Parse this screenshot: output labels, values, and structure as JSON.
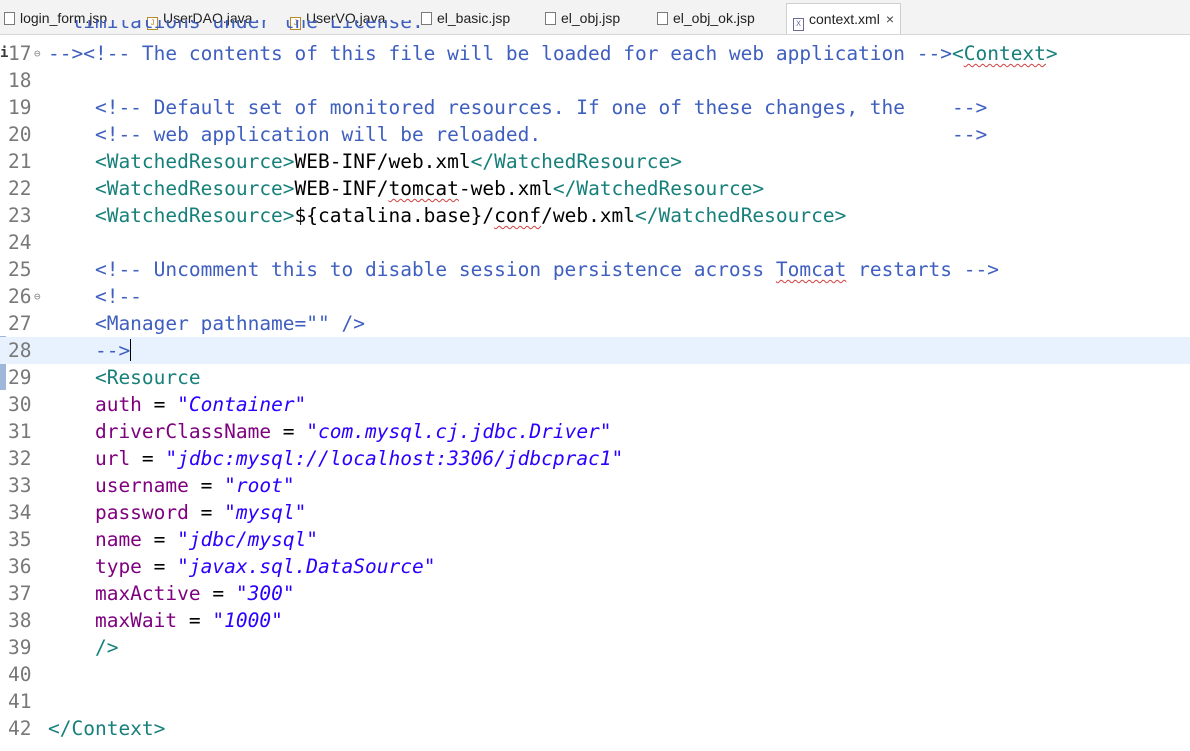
{
  "tabs": [
    {
      "label": "login_form.jsp",
      "icon": "jsp-file-icon",
      "active": false
    },
    {
      "label": "UserDAO.java",
      "icon": "java-file-icon",
      "active": false
    },
    {
      "label": "UserVO.java",
      "icon": "java-file-icon",
      "active": false
    },
    {
      "label": "el_basic.jsp",
      "icon": "jsp-file-icon",
      "active": false
    },
    {
      "label": "el_obj.jsp",
      "icon": "jsp-file-icon",
      "active": false
    },
    {
      "label": "el_obj_ok.jsp",
      "icon": "jsp-file-icon",
      "active": false
    },
    {
      "label": "context.xml",
      "icon": "xml-file-icon",
      "active": true
    }
  ],
  "close_glyph": "×",
  "editor": {
    "partial_top_line": "  limitations under the License.",
    "lines": [
      {
        "n": "17",
        "info": "i",
        "fold": "⊖",
        "parts": [
          [
            "com",
            "--><!-- The contents of this file will be loaded for each web application -->"
          ],
          [
            "tag",
            "<"
          ],
          [
            "tagsq",
            "Context"
          ],
          [
            "tag",
            ">"
          ]
        ]
      },
      {
        "n": "18",
        "parts": []
      },
      {
        "n": "19",
        "parts": [
          [
            "com",
            "    <!-- Default set of monitored resources. If one of these changes, the    -->"
          ]
        ]
      },
      {
        "n": "20",
        "parts": [
          [
            "com",
            "    <!-- web application will be reloaded.                                   -->"
          ]
        ]
      },
      {
        "n": "21",
        "parts": [
          [
            "tag",
            "    <WatchedResource>"
          ],
          [
            "txt",
            "WEB-INF/web.xml"
          ],
          [
            "tag",
            "</WatchedResource>"
          ]
        ]
      },
      {
        "n": "22",
        "parts": [
          [
            "tag",
            "    <WatchedResource>"
          ],
          [
            "txt",
            "WEB-INF/"
          ],
          [
            "txtsq",
            "tomcat"
          ],
          [
            "txt",
            "-web.xml"
          ],
          [
            "tag",
            "</WatchedResource>"
          ]
        ]
      },
      {
        "n": "23",
        "parts": [
          [
            "tag",
            "    <WatchedResource>"
          ],
          [
            "txt",
            "${catalina.base}/"
          ],
          [
            "txtsq",
            "conf"
          ],
          [
            "txt",
            "/web.xml"
          ],
          [
            "tag",
            "</WatchedResource>"
          ]
        ]
      },
      {
        "n": "24",
        "parts": []
      },
      {
        "n": "25",
        "parts": [
          [
            "com",
            "    <!-- Uncomment this to disable session persistence across "
          ],
          [
            "comsq",
            "Tomcat"
          ],
          [
            "com",
            " restarts -->"
          ]
        ]
      },
      {
        "n": "26",
        "fold": "⊖",
        "parts": [
          [
            "com",
            "    <!--"
          ]
        ]
      },
      {
        "n": "27",
        "parts": [
          [
            "com",
            "    <Manager pathname=\"\" />"
          ]
        ]
      },
      {
        "n": "28",
        "current": true,
        "parts": [
          [
            "com",
            "    -->"
          ],
          [
            "cursor",
            ""
          ]
        ]
      },
      {
        "n": "29",
        "parts": [
          [
            "tag",
            "    <Resource"
          ]
        ]
      },
      {
        "n": "30",
        "parts": [
          [
            "attr",
            "    auth"
          ],
          [
            "eq",
            " = "
          ],
          [
            "str",
            "\"Container\""
          ]
        ]
      },
      {
        "n": "31",
        "parts": [
          [
            "attr",
            "    driverClassName"
          ],
          [
            "eq",
            " = "
          ],
          [
            "str",
            "\"com.mysql.cj.jdbc.Driver\""
          ]
        ]
      },
      {
        "n": "32",
        "parts": [
          [
            "attr",
            "    url"
          ],
          [
            "eq",
            " = "
          ],
          [
            "str",
            "\"jdbc:mysql://localhost:3306/jdbcprac1\""
          ]
        ]
      },
      {
        "n": "33",
        "parts": [
          [
            "attr",
            "    username"
          ],
          [
            "eq",
            " = "
          ],
          [
            "str",
            "\"root\""
          ]
        ]
      },
      {
        "n": "34",
        "parts": [
          [
            "attr",
            "    password"
          ],
          [
            "eq",
            " = "
          ],
          [
            "str",
            "\"mysql\""
          ]
        ]
      },
      {
        "n": "35",
        "parts": [
          [
            "attr",
            "    name"
          ],
          [
            "eq",
            " = "
          ],
          [
            "str",
            "\"jdbc/mysql\""
          ]
        ]
      },
      {
        "n": "36",
        "parts": [
          [
            "attr",
            "    type"
          ],
          [
            "eq",
            " = "
          ],
          [
            "str",
            "\"javax.sql.DataSource\""
          ]
        ]
      },
      {
        "n": "37",
        "parts": [
          [
            "attr",
            "    maxActive"
          ],
          [
            "eq",
            " = "
          ],
          [
            "str",
            "\"300\""
          ]
        ]
      },
      {
        "n": "38",
        "parts": [
          [
            "attr",
            "    maxWait"
          ],
          [
            "eq",
            " = "
          ],
          [
            "str",
            "\"1000\""
          ]
        ]
      },
      {
        "n": "39",
        "parts": [
          [
            "tag",
            "    />"
          ]
        ]
      },
      {
        "n": "40",
        "parts": []
      },
      {
        "n": "41",
        "parts": []
      },
      {
        "n": "42",
        "parts": [
          [
            "tag",
            "</Context>"
          ]
        ]
      }
    ]
  }
}
